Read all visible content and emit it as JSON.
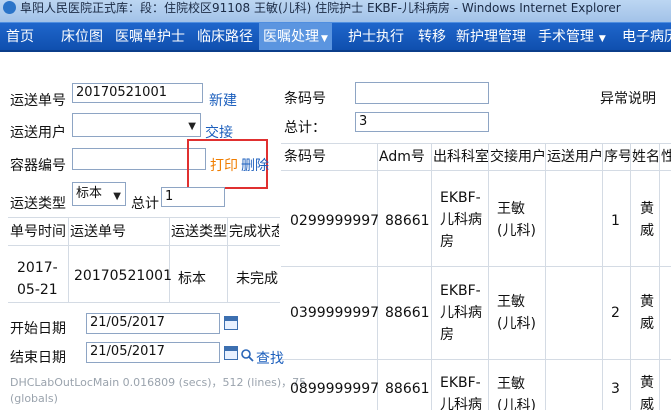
{
  "window": {
    "title": "阜阳人民医院正式库：段：住院校区91108 王敏(儿科) 住院护士 EKBF-儿科病房 - Windows Internet Explorer"
  },
  "nav": {
    "items": [
      "首页",
      "床位图",
      "医嘱单护士",
      "临床路径",
      "医嘱处理",
      "护士执行",
      "转移",
      "新护理管理",
      "手术管理",
      "电子病历"
    ],
    "active_index": 4
  },
  "form": {
    "transfer_no_label": "运送单号",
    "transfer_no_value": "20170521001",
    "new_link": "新建",
    "user_label": "运送用户",
    "user_value": "",
    "handover_link": "交接",
    "container_label": "容器编号",
    "container_value": "",
    "print_link": "打印",
    "delete_link": "删除",
    "type_label": "运送类型",
    "type_value": "标本",
    "total_label": "总计",
    "total_value": "1",
    "start_label": "开始日期",
    "start_value": "21/05/2017",
    "end_label": "结束日期",
    "end_value": "21/05/2017",
    "find_link": "查找"
  },
  "left_table": {
    "headers": [
      "单号时间",
      "运送单号",
      "运送类型",
      "完成状态"
    ],
    "rows": [
      {
        "time_line1": "2017-",
        "time_line2": "05-21",
        "no": "20170521001",
        "type": "标本",
        "status": "未完成"
      }
    ]
  },
  "status_bar": {
    "line1": "DHCLabOutLocMain  0.016809 (secs)，512 (lines)，75",
    "line2": "(globals)"
  },
  "right": {
    "barcode_label": "条码号",
    "barcode_value": "",
    "abnormal_label": "异常说明",
    "total_label": "总计：",
    "total_value": "3",
    "headers": [
      "条码号",
      "Adm号",
      "出科科室",
      "交接用户",
      "运送用户",
      "序号",
      "姓名",
      "性"
    ],
    "rows": [
      {
        "barcode": "0299999997",
        "adm": "88661",
        "dept1": "EKBF-",
        "dept2": "儿科病",
        "dept3": "房",
        "user1": "王敏",
        "user2": "(儿科)",
        "seq": "1",
        "name1": "黄",
        "name2": "威"
      },
      {
        "barcode": "0399999997",
        "adm": "88661",
        "dept1": "EKBF-",
        "dept2": "儿科病",
        "dept3": "房",
        "user1": "王敏",
        "user2": "(儿科)",
        "seq": "2",
        "name1": "黄",
        "name2": "威"
      },
      {
        "barcode": "0899999997",
        "adm": "88661",
        "dept1": "EKBF-",
        "dept2": "儿科病",
        "dept3": "房",
        "user1": "王敏",
        "user2": "(儿科)",
        "seq": "3",
        "name1": "黄",
        "name2": "威"
      }
    ]
  },
  "colors": {
    "nav_bg": "#1558c0",
    "nav_active": "#5b95e0",
    "link": "#1c5fbd",
    "print_link": "#f07d00",
    "highlight_box": "#e03030"
  }
}
